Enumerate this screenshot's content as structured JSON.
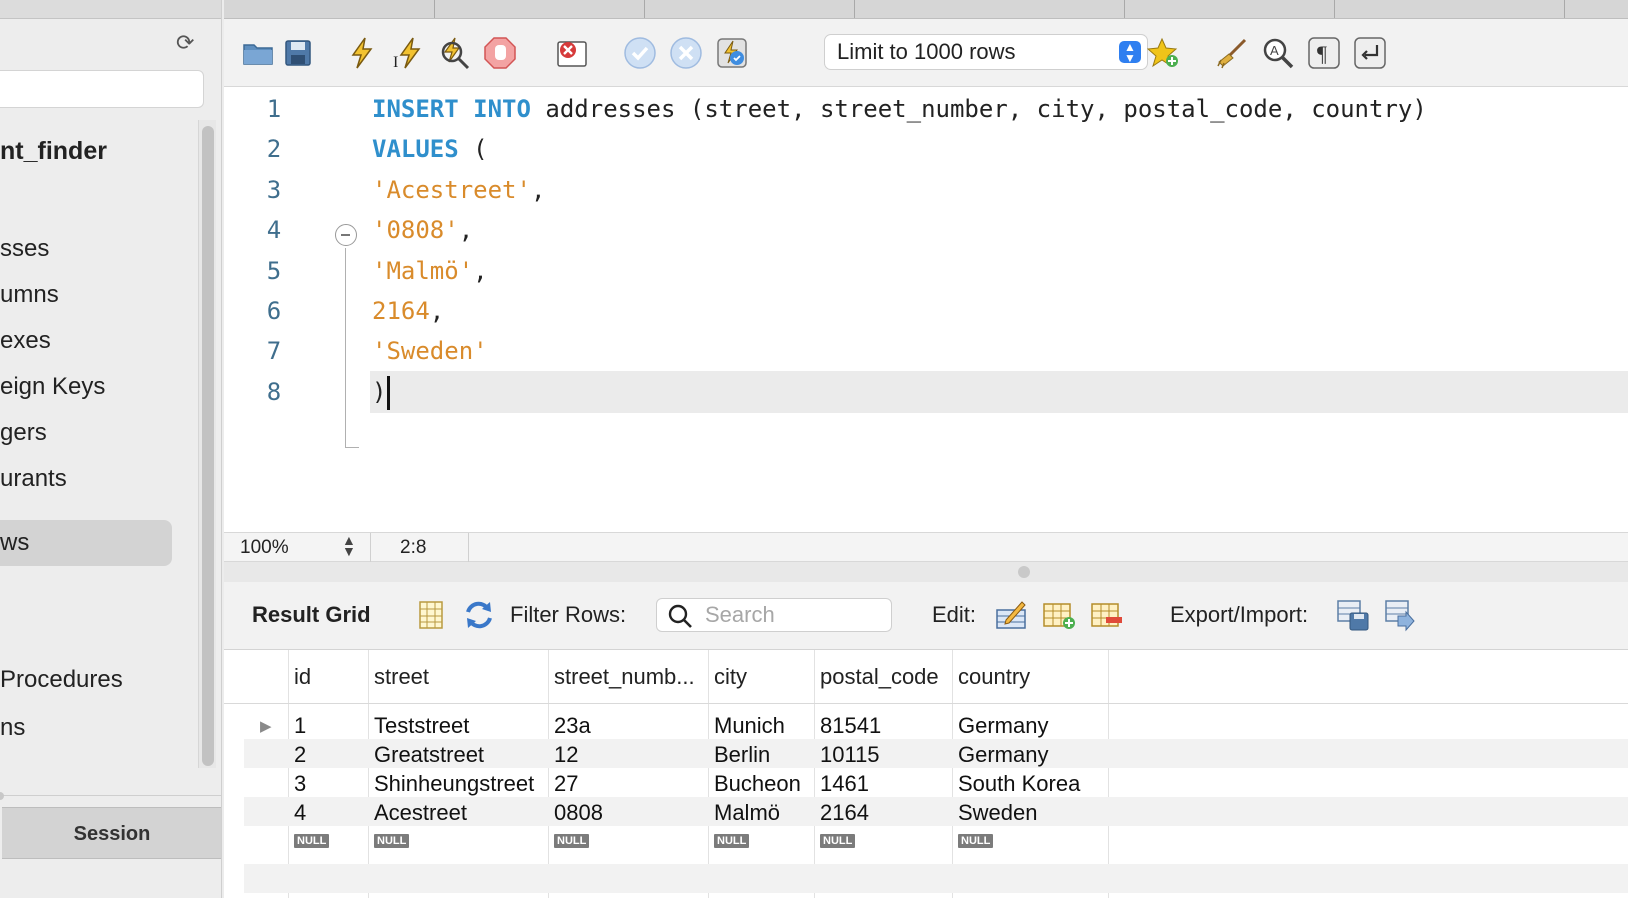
{
  "sidebar": {
    "schema_name": "nt_finder",
    "items": [
      {
        "label": "sses"
      },
      {
        "label": "umns"
      },
      {
        "label": "exes"
      },
      {
        "label": "eign Keys"
      },
      {
        "label": "gers"
      },
      {
        "label": "urants"
      },
      {
        "label": "ws"
      },
      {
        "label": "Procedures"
      },
      {
        "label": "ns"
      }
    ],
    "session_label": "Session"
  },
  "toolbar": {
    "limit_label": "Limit to 1000 rows",
    "icons": [
      "open-folder-icon",
      "save-icon",
      "execute-icon",
      "execute-current-icon",
      "explain-icon",
      "stop-icon",
      "toggle-error-icon",
      "commit-icon",
      "rollback-icon",
      "autocommit-icon",
      "bookmark-icon",
      "beautify-icon",
      "find-icon",
      "invisibles-icon",
      "wrap-icon"
    ]
  },
  "editor": {
    "lines": [
      {
        "no": "1",
        "parts": [
          [
            "kw",
            "INSERT INTO"
          ],
          [
            "plain",
            " addresses (street, street_number, city, postal_code, country)"
          ]
        ]
      },
      {
        "no": "2",
        "parts": [
          [
            "kw",
            "VALUES"
          ],
          [
            "plain",
            " ("
          ]
        ]
      },
      {
        "no": "3",
        "parts": [
          [
            "str",
            "'Acestreet'"
          ],
          [
            "plain",
            ","
          ]
        ]
      },
      {
        "no": "4",
        "parts": [
          [
            "str",
            "'0808'"
          ],
          [
            "plain",
            ","
          ]
        ]
      },
      {
        "no": "5",
        "parts": [
          [
            "str",
            "'Malmö'"
          ],
          [
            "plain",
            ","
          ]
        ]
      },
      {
        "no": "6",
        "parts": [
          [
            "num",
            "2164"
          ],
          [
            "plain",
            ","
          ]
        ]
      },
      {
        "no": "7",
        "parts": [
          [
            "str",
            "'Sweden'"
          ]
        ]
      },
      {
        "no": "8",
        "parts": [
          [
            "plain",
            ")"
          ]
        ]
      }
    ],
    "current_line": 8
  },
  "status": {
    "zoom": "100%",
    "cursor_position": "2:8"
  },
  "result": {
    "title": "Result Grid",
    "filter_label": "Filter Rows:",
    "search_placeholder": "Search",
    "edit_label": "Edit:",
    "export_label": "Export/Import:",
    "columns": [
      "id",
      "street",
      "street_numb...",
      "city",
      "postal_code",
      "country"
    ],
    "rows": [
      [
        "1",
        "Teststreet",
        "23a",
        "Munich",
        "81541",
        "Germany"
      ],
      [
        "2",
        "Greatstreet",
        "12",
        "Berlin",
        "10115",
        "Germany"
      ],
      [
        "3",
        "Shinheungstreet",
        "27",
        "Bucheon",
        "1461",
        "South Korea"
      ],
      [
        "4",
        "Acestreet",
        "0808",
        "Malmö",
        "2164",
        "Sweden"
      ]
    ],
    "null_label": "NULL"
  },
  "colors": {
    "keyword": "#2f8fcc",
    "string": "#d98b2b",
    "line_number": "#3f6e8d"
  }
}
